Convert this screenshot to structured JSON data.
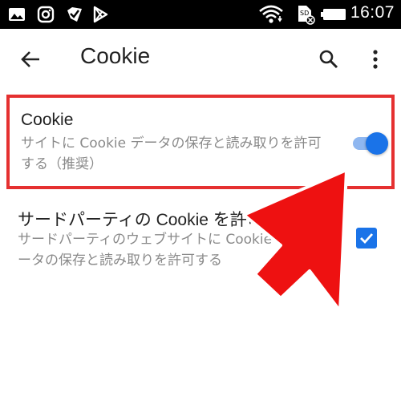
{
  "status_bar": {
    "time": "16:07",
    "icons": [
      "gallery-icon",
      "instagram-icon",
      "check-app-icon",
      "play-store-icon",
      "wifi-icon",
      "sim-card-icon",
      "battery-icon"
    ]
  },
  "toolbar": {
    "title": "Cookie"
  },
  "settings": {
    "cookie": {
      "title": "Cookie",
      "summary": "サイトに Cookie データの保存と読み取りを許可する（推奨）",
      "enabled": true
    },
    "third_party": {
      "title": "サードパーティの Cookie を許可",
      "summary": "サードパーティのウェブサイトに Cookie データの保存と読み取りを許可する",
      "checked": true
    }
  },
  "colors": {
    "accent": "#1a73e8",
    "highlight": "#e53030",
    "status_bar": "#000000"
  }
}
